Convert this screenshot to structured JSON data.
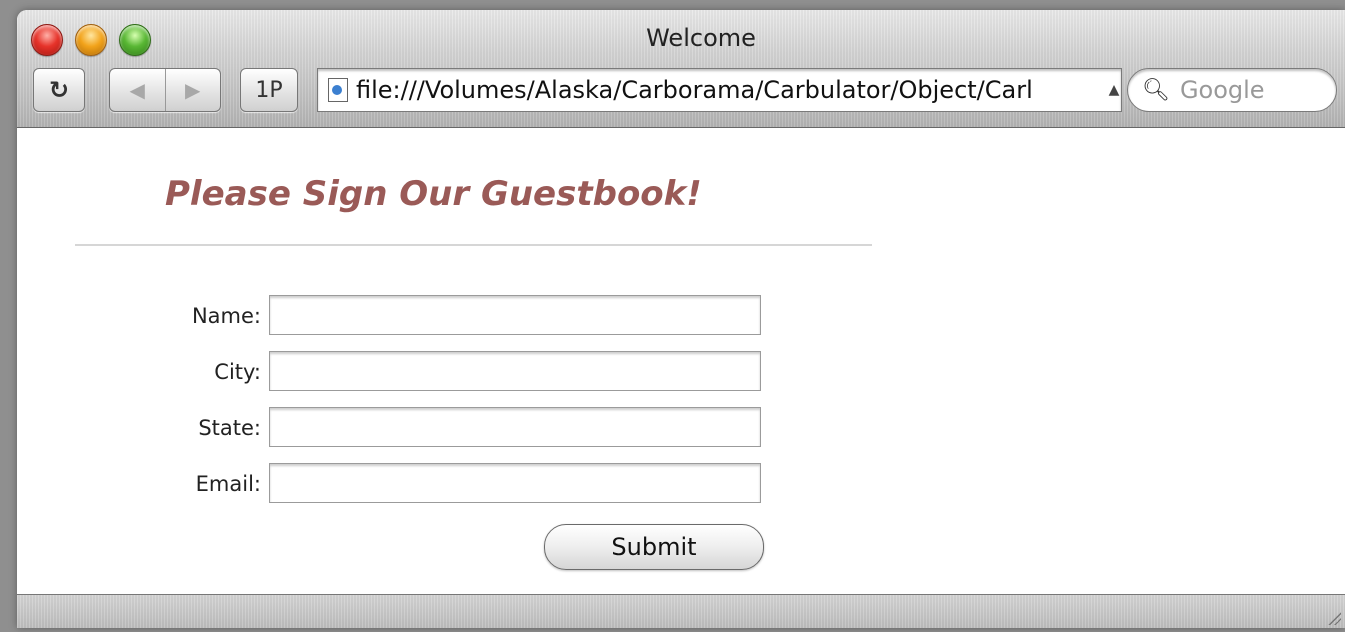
{
  "window": {
    "title": "Welcome"
  },
  "toolbar": {
    "reload_icon": "reload-icon",
    "back_icon": "back-arrow-icon",
    "forward_icon": "forward-arrow-icon",
    "snapback_label": "1P",
    "address": "file:///Volumes/Alaska/Carborama/Carbulator/Object/Carl",
    "search_placeholder": "Google"
  },
  "page": {
    "heading": "Please Sign Our Guestbook!",
    "heading_color": "#9a5a57",
    "fields": [
      {
        "label": "Name:",
        "value": ""
      },
      {
        "label": "City:",
        "value": ""
      },
      {
        "label": "State:",
        "value": ""
      },
      {
        "label": "Email:",
        "value": ""
      }
    ],
    "submit_label": "Submit"
  }
}
